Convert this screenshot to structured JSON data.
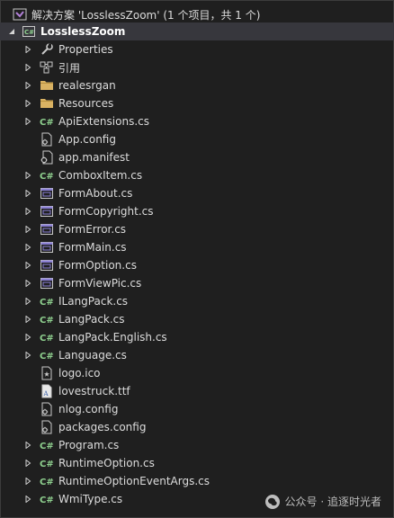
{
  "solution": {
    "label": "解决方案 'LosslessZoom' (1 个项目，共 1 个)"
  },
  "project": {
    "label": "LosslessZoom"
  },
  "items": [
    {
      "label": "Properties",
      "icon": "wrench-icon",
      "expandable": true
    },
    {
      "label": "引用",
      "icon": "references-icon",
      "expandable": true
    },
    {
      "label": "realesrgan",
      "icon": "folder-icon",
      "expandable": true
    },
    {
      "label": "Resources",
      "icon": "folder-icon",
      "expandable": true
    },
    {
      "label": "ApiExtensions.cs",
      "icon": "csharp-file-icon",
      "expandable": true
    },
    {
      "label": "App.config",
      "icon": "config-file-icon",
      "expandable": false
    },
    {
      "label": "app.manifest",
      "icon": "manifest-file-icon",
      "expandable": false
    },
    {
      "label": "ComboxItem.cs",
      "icon": "csharp-file-icon",
      "expandable": true
    },
    {
      "label": "FormAbout.cs",
      "icon": "form-icon",
      "expandable": true
    },
    {
      "label": "FormCopyright.cs",
      "icon": "form-icon",
      "expandable": true
    },
    {
      "label": "FormError.cs",
      "icon": "form-icon",
      "expandable": true
    },
    {
      "label": "FormMain.cs",
      "icon": "form-icon",
      "expandable": true
    },
    {
      "label": "FormOption.cs",
      "icon": "form-icon",
      "expandable": true
    },
    {
      "label": "FormViewPic.cs",
      "icon": "form-icon",
      "expandable": true
    },
    {
      "label": "ILangPack.cs",
      "icon": "csharp-file-icon",
      "expandable": true
    },
    {
      "label": "LangPack.cs",
      "icon": "csharp-file-icon",
      "expandable": true
    },
    {
      "label": "LangPack.English.cs",
      "icon": "csharp-file-icon",
      "expandable": true
    },
    {
      "label": "Language.cs",
      "icon": "csharp-file-icon",
      "expandable": true
    },
    {
      "label": "logo.ico",
      "icon": "ico-file-icon",
      "expandable": false
    },
    {
      "label": "lovestruck.ttf",
      "icon": "font-file-icon",
      "expandable": false
    },
    {
      "label": "nlog.config",
      "icon": "config-file-icon",
      "expandable": false
    },
    {
      "label": "packages.config",
      "icon": "config-file-icon",
      "expandable": false
    },
    {
      "label": "Program.cs",
      "icon": "csharp-file-icon",
      "expandable": true
    },
    {
      "label": "RuntimeOption.cs",
      "icon": "csharp-file-icon",
      "expandable": true
    },
    {
      "label": "RuntimeOptionEventArgs.cs",
      "icon": "csharp-file-icon",
      "expandable": true
    },
    {
      "label": "WmiType.cs",
      "icon": "csharp-file-icon",
      "expandable": true
    }
  ],
  "watermark": {
    "text": "公众号 · 追逐时光者"
  }
}
